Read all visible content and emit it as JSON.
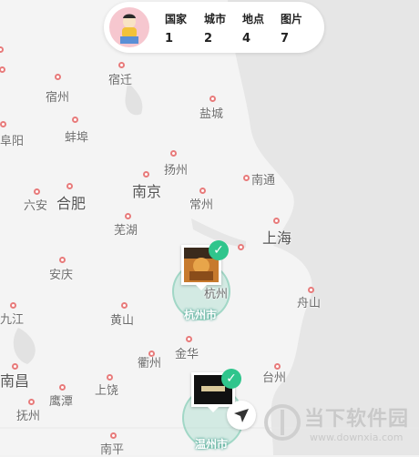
{
  "stats": [
    {
      "label": "国家",
      "value": "1"
    },
    {
      "label": "城市",
      "value": "2"
    },
    {
      "label": "地点",
      "value": "4"
    },
    {
      "label": "图片",
      "value": "7"
    }
  ],
  "cities": {
    "suqian": "宿迁",
    "suzhou_ah": "宿州",
    "yancheng": "盐城",
    "bengbu": "蚌埠",
    "fuyang": "阜阳",
    "yangzhou": "扬州",
    "nantong": "南通",
    "nanjing": "南京",
    "changzhou": "常州",
    "liuan": "六安",
    "hefei": "合肥",
    "wuhu": "芜湖",
    "shanghai": "上海",
    "anqing": "安庆",
    "hangzhou": "杭州",
    "zhoushan": "舟山",
    "jiujiang": "九江",
    "huangshan": "黄山",
    "jinhua": "金华",
    "quzhou": "衢州",
    "taizhou": "台州",
    "nanchang": "南昌",
    "yingtan": "鹰潭",
    "shangrao": "上饶",
    "fuzhou_jx": "抚州",
    "nanping": "南平",
    "wenzhou": "温州"
  },
  "clusters": [
    {
      "label": "杭州市"
    },
    {
      "label": "温州市"
    }
  ],
  "watermark": {
    "text": "当下软件园",
    "url": "www.downxia.com"
  },
  "colors": {
    "accent": "#2fc58c",
    "city_dot": "#e87b7b",
    "sea": "#e6e6e6"
  }
}
